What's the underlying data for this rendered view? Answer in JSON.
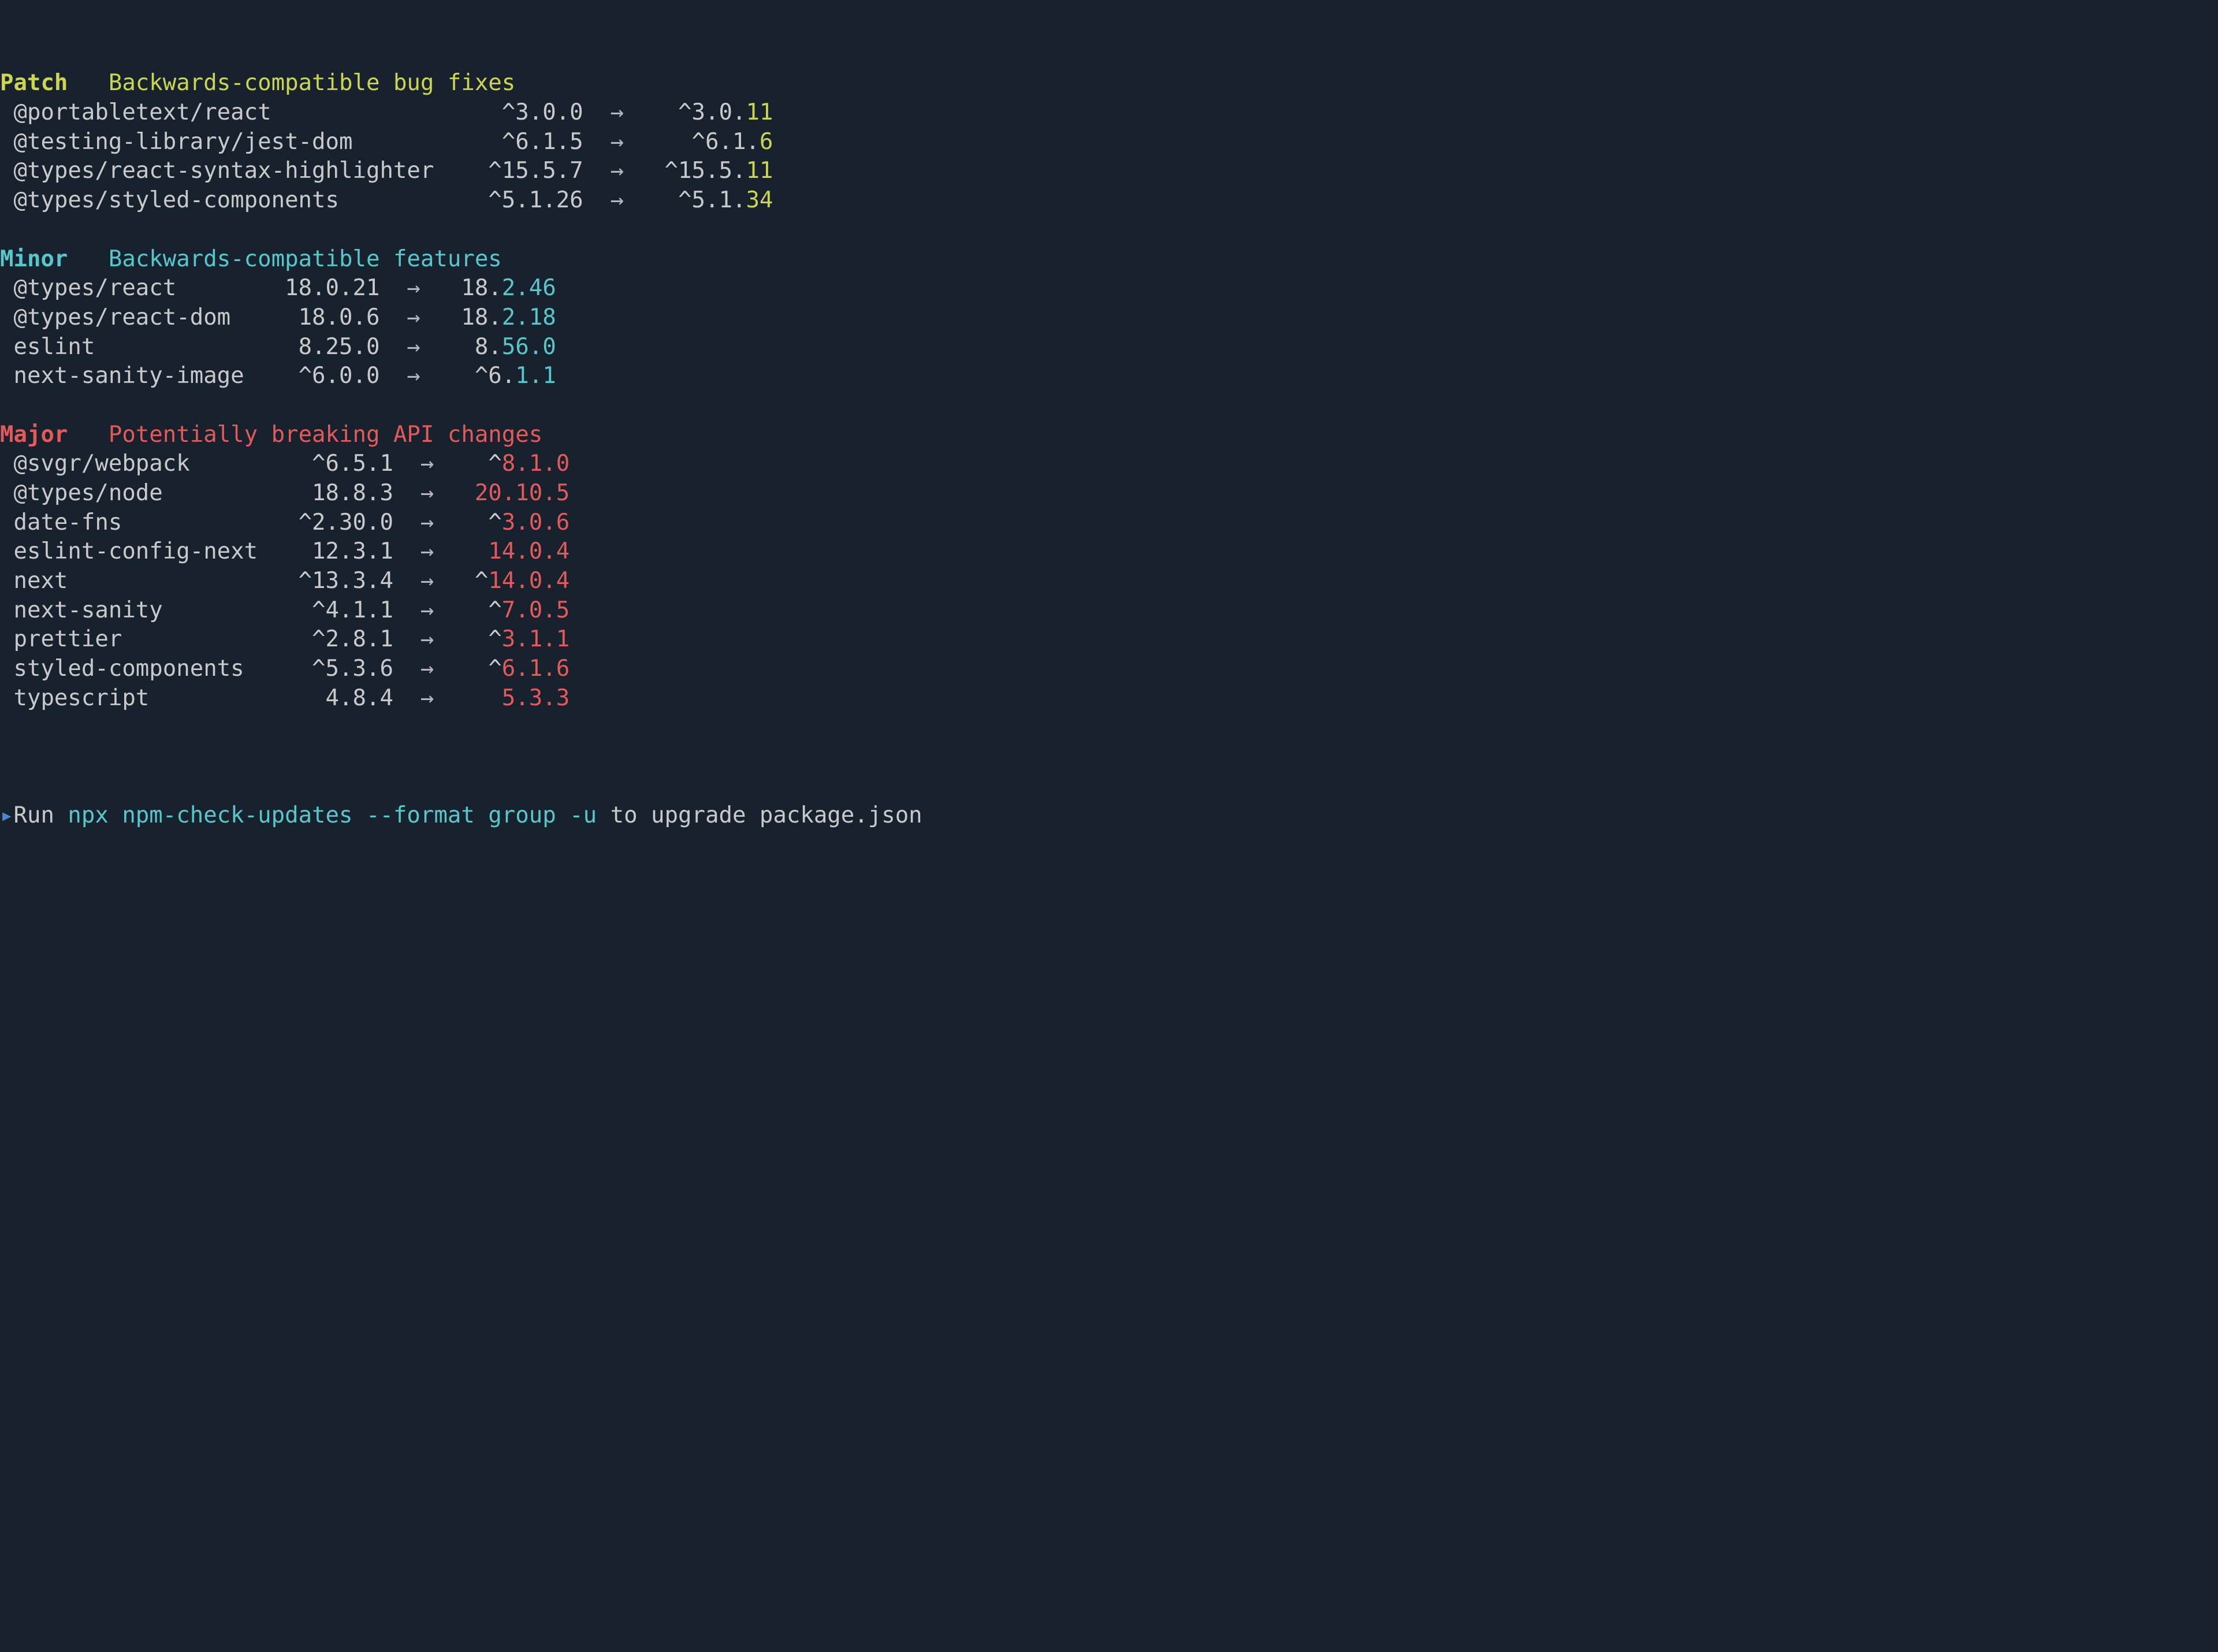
{
  "sections": [
    {
      "label": "Patch",
      "desc": "Backwards-compatible bug fixes",
      "color": "yellow",
      "name_w": 34,
      "from_w": 8,
      "to_w": 9,
      "rows": [
        {
          "name": "@portabletext/react",
          "from": "^3.0.0",
          "to_pre": "^3.0.",
          "to_hi": "11"
        },
        {
          "name": "@testing-library/jest-dom",
          "from": "^6.1.5",
          "to_pre": "^6.1.",
          "to_hi": "6"
        },
        {
          "name": "@types/react-syntax-highlighter",
          "from": "^15.5.7",
          "to_pre": "^15.5.",
          "to_hi": "11"
        },
        {
          "name": "@types/styled-components",
          "from": "^5.1.26",
          "to_pre": "^5.1.",
          "to_hi": "34"
        }
      ]
    },
    {
      "label": "Minor",
      "desc": "Backwards-compatible features",
      "color": "cyan",
      "name_w": 19,
      "from_w": 8,
      "to_w": 8,
      "rows": [
        {
          "name": "@types/react",
          "from": "18.0.21",
          "to_pre": "18.",
          "to_hi": "2.46"
        },
        {
          "name": "@types/react-dom",
          "from": "18.0.6",
          "to_pre": "18.",
          "to_hi": "2.18"
        },
        {
          "name": "eslint",
          "from": "8.25.0",
          "to_pre": "8.",
          "to_hi": "56.0"
        },
        {
          "name": "next-sanity-image",
          "from": "^6.0.0",
          "to_pre": "^6.",
          "to_hi": "1.1"
        }
      ]
    },
    {
      "label": "Major",
      "desc": "Potentially breaking API changes",
      "color": "red",
      "name_w": 20,
      "from_w": 8,
      "to_w": 8,
      "rows": [
        {
          "name": "@svgr/webpack",
          "from": "^6.5.1",
          "to_pre": "^",
          "to_hi": "8.1.0"
        },
        {
          "name": "@types/node",
          "from": "18.8.3",
          "to_pre": "",
          "to_hi": "20.10.5"
        },
        {
          "name": "date-fns",
          "from": "^2.30.0",
          "to_pre": "^",
          "to_hi": "3.0.6"
        },
        {
          "name": "eslint-config-next",
          "from": "12.3.1",
          "to_pre": "",
          "to_hi": "14.0.4"
        },
        {
          "name": "next",
          "from": "^13.3.4",
          "to_pre": "^",
          "to_hi": "14.0.4"
        },
        {
          "name": "next-sanity",
          "from": "^4.1.1",
          "to_pre": "^",
          "to_hi": "7.0.5"
        },
        {
          "name": "prettier",
          "from": "^2.8.1",
          "to_pre": "^",
          "to_hi": "3.1.1"
        },
        {
          "name": "styled-components",
          "from": "^5.3.6",
          "to_pre": "^",
          "to_hi": "6.1.6"
        },
        {
          "name": "typescript",
          "from": "4.8.4",
          "to_pre": "",
          "to_hi": "5.3.3"
        }
      ]
    }
  ],
  "footer": {
    "caret": "▸",
    "pre": "Run ",
    "cmd": "npx npm-check-updates --format group -u",
    "post": " to upgrade package.json"
  }
}
